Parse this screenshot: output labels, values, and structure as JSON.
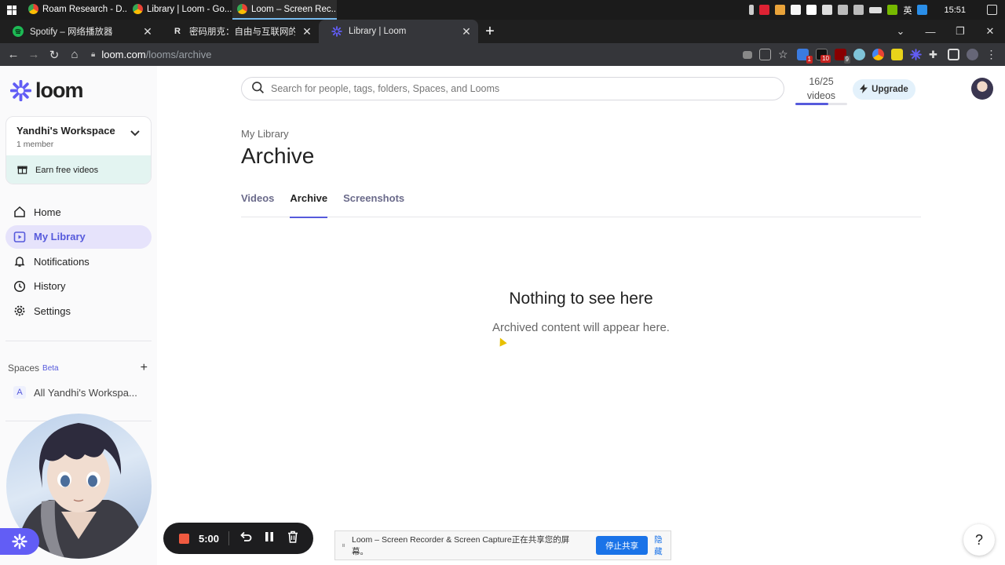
{
  "taskbar": {
    "apps": [
      {
        "label": "Roam Research - D...",
        "color": "#ffffff"
      },
      {
        "label": "Library | Loom - Go...",
        "color": "#4caf50"
      },
      {
        "label": "Loom – Screen Rec...",
        "color": "#4caf50"
      }
    ],
    "tray": {
      "ime": "英",
      "time": "15:51"
    }
  },
  "browser": {
    "tabs": [
      {
        "title": "Spotify – 网络播放器",
        "favicon": "spotify-icon",
        "color": "#1db954"
      },
      {
        "title": "密码朋克：自由与互联网的未来",
        "favicon": "R",
        "color": "#ffffff"
      },
      {
        "title": "Library | Loom",
        "favicon": "loom-icon",
        "color": "#625df5"
      }
    ],
    "url_host": "loom.com",
    "url_path": "/looms/archive"
  },
  "sidebar": {
    "logo_text": "loom",
    "workspace": {
      "name": "Yandhi's Workspace",
      "members": "1 member"
    },
    "earn_label": "Earn free videos",
    "nav": [
      {
        "label": "Home",
        "icon": "home-icon"
      },
      {
        "label": "My Library",
        "icon": "library-icon",
        "active": true
      },
      {
        "label": "Notifications",
        "icon": "bell-icon"
      },
      {
        "label": "History",
        "icon": "clock-icon"
      },
      {
        "label": "Settings",
        "icon": "gear-icon"
      }
    ],
    "spaces_label": "Spaces",
    "spaces_beta": "Beta",
    "space_item": {
      "avatar": "A",
      "label": "All Yandhi's Workspa..."
    }
  },
  "header": {
    "search_placeholder": "Search for people, tags, folders, Spaces, and Looms",
    "quota_count": "16/25",
    "quota_unit": "videos",
    "quota_fraction": 0.64,
    "upgrade_label": "Upgrade"
  },
  "page": {
    "breadcrumb": "My Library",
    "title": "Archive",
    "tabs": [
      {
        "label": "Videos"
      },
      {
        "label": "Archive",
        "active": true
      },
      {
        "label": "Screenshots"
      }
    ],
    "empty_title": "Nothing to see here",
    "empty_sub": "Archived content will appear here."
  },
  "recorder": {
    "time": "5:00"
  },
  "sharebar": {
    "message": "Loom – Screen Recorder & Screen Capture正在共享您的屏幕。",
    "stop_label": "停止共享",
    "hide_label": "隐藏"
  },
  "help_label": "?",
  "colors": {
    "accent": "#565adc",
    "loom_brand": "#625df5"
  }
}
